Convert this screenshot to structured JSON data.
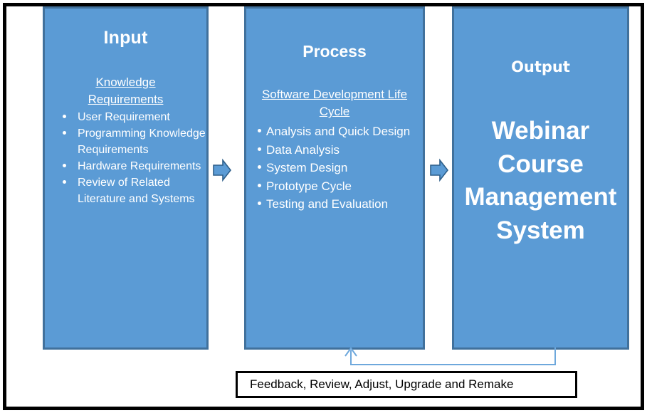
{
  "diagram": {
    "frame_color": "#000000",
    "panel_fill": "#5b9bd5",
    "panel_border": "#41719c",
    "text_color": "#ffffff",
    "input": {
      "title": "Input",
      "subhead": "Knowledge Requirements",
      "bullets": [
        "User Requirement",
        "Programming Knowledge Requirements",
        "Hardware Requirements",
        "Review of Related Literature and Systems"
      ]
    },
    "process": {
      "title": "Process",
      "subhead": "Software Development Life Cycle",
      "bullets": [
        "Analysis and Quick Design",
        "Data Analysis",
        "System Design",
        "Prototype Cycle",
        "Testing and Evaluation"
      ]
    },
    "output": {
      "title": "Output",
      "body": "Webinar Course Management System"
    },
    "feedback": {
      "text": "Feedback, Review, Adjust, Upgrade and Remake",
      "connector_color": "#5b9bd5",
      "border_color": "#000000"
    },
    "arrows": {
      "arrow_1_name": "input-to-process",
      "arrow_2_name": "process-to-output",
      "fill": "#5b9bd5",
      "stroke": "#2e5f8a"
    }
  }
}
